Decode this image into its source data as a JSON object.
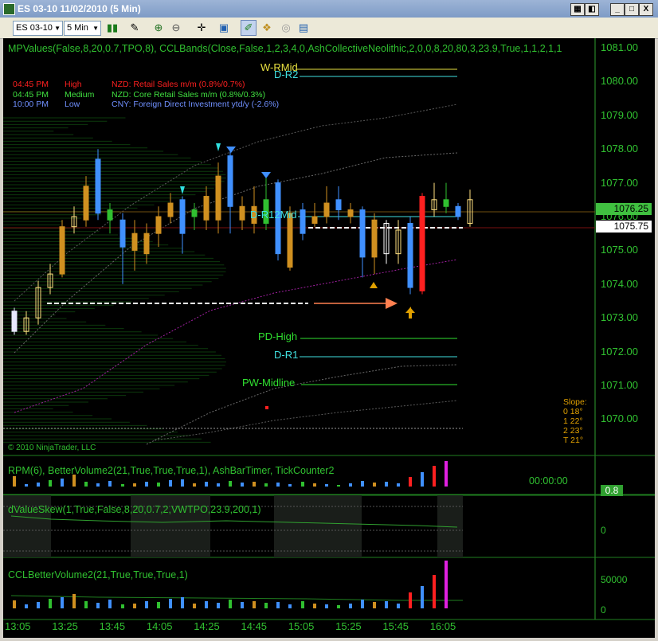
{
  "window": {
    "title": "ES 03-10  11/02/2010 (5 Min)",
    "min_label": "_",
    "max_label": "□",
    "close_label": "X"
  },
  "toolbar": {
    "instrument": "ES 03-10",
    "interval": "5 Min"
  },
  "chart": {
    "header": "MPValues(False,8,20,0.7,TPO,8), CCLBands(Close,False,1,2,3,4,0,AshCollectiveNeolithic,2,0,0,8,20,80,3,23.9,True,1,1,2,1,1",
    "copyright": "© 2010 NinjaTrader, LLC",
    "news": [
      {
        "time": "04:45 PM",
        "impact": "High",
        "text": "NZD: Retail Sales m/m (0.8%/0.7%)",
        "color": "#ff2020"
      },
      {
        "time": "04:45 PM",
        "impact": "Medium",
        "text": "NZD: Core Retail Sales m/m (0.8%/0.3%)",
        "color": "#40e040"
      },
      {
        "time": "10:00 PM",
        "impact": "Low",
        "text": "CNY: Foreign Direct Investment ytd/y (-2.6%)",
        "color": "#7090ff"
      }
    ],
    "levels": [
      {
        "label": "W-RMid",
        "price": 1081.3,
        "color": "#e8e040"
      },
      {
        "label": "D-R2",
        "price": 1081.25,
        "color": "#40e0e0"
      },
      {
        "label": "D-R12Mid",
        "price": 1076.15,
        "color": "#40e0e0"
      },
      {
        "label": "PD-High",
        "price": 1072.5,
        "color": "#30e030"
      },
      {
        "label": "D-R1",
        "price": 1071.95,
        "color": "#40e0e0"
      },
      {
        "label": "PW-Midline",
        "price": 1071.1,
        "color": "#30e030"
      }
    ],
    "price_tags": [
      {
        "value": "1076.25",
        "bg": "#40c040"
      },
      {
        "value": "1075.75",
        "bg": "#ffffff"
      }
    ],
    "price_axis": [
      "1081.00",
      "1080.00",
      "1079.00",
      "1078.00",
      "1077.00",
      "1076.00",
      "1075.00",
      "1074.00",
      "1073.00",
      "1072.00",
      "1071.00",
      "1070.00"
    ],
    "slope": {
      "title": "Slope:",
      "rows": [
        "0  18°",
        "1  22°",
        "2  23°",
        "T  21°"
      ]
    }
  },
  "panels": [
    {
      "header": "RPM(6), BetterVolume2(21,True,True,True,1), AshBarTimer, TickCounter2",
      "timer": "00:00:00",
      "tag": "0.8"
    },
    {
      "header": "dValueSkew(1,True,False,8,20,0.7,2,VWTPO,23.9,200,1)",
      "axis": "0"
    },
    {
      "header": "CCLBetterVolume2(21,True,True,True,1)",
      "axis_top": "50000",
      "axis_bottom": "0"
    }
  ],
  "time_axis": [
    "13:05",
    "13:25",
    "13:45",
    "14:05",
    "14:25",
    "14:45",
    "15:05",
    "15:25",
    "15:45",
    "16:05"
  ],
  "chart_data": {
    "type": "candlestick",
    "x": [
      "13:05",
      "13:25",
      "13:45",
      "14:05",
      "14:25",
      "14:45",
      "15:05",
      "15:25",
      "15:45",
      "16:05"
    ],
    "ylim": [
      1069.5,
      1081.5
    ],
    "last_price": 1076.25
  }
}
